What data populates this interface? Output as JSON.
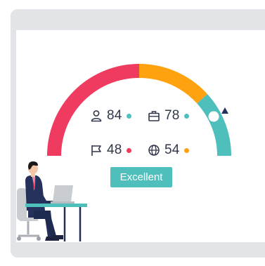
{
  "colors": {
    "red": "#ef3b5f",
    "orange": "#ffa20f",
    "teal": "#4fbfbc",
    "navy": "#25315a",
    "frame": "#e2e4e8",
    "text": "#2f3748"
  },
  "score": {
    "gauge_level": 0.83,
    "rating_label": "Excellent"
  },
  "metrics": [
    {
      "icon": "person-icon",
      "value": "84",
      "dot_color": "#4fbfbc"
    },
    {
      "icon": "briefcase-icon",
      "value": "78",
      "dot_color": "#4fbfbc"
    },
    {
      "icon": "flag-icon",
      "value": "48",
      "dot_color": "#ef3b5f"
    },
    {
      "icon": "globe-icon",
      "value": "54",
      "dot_color": "#ffa20f"
    }
  ]
}
